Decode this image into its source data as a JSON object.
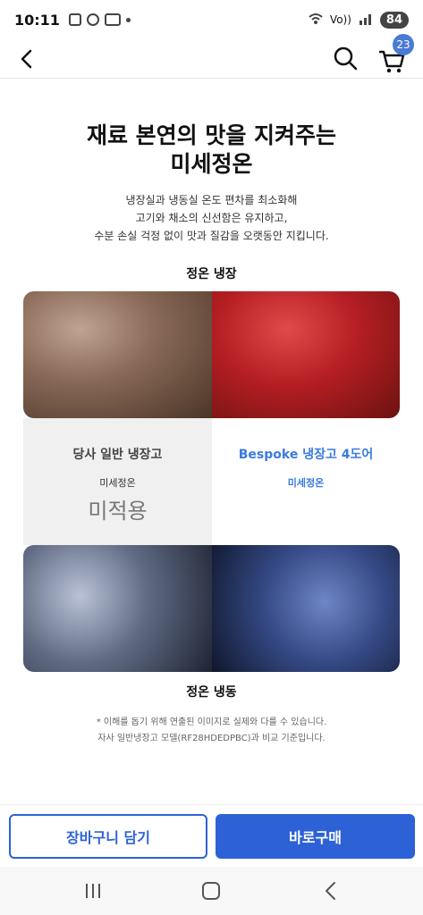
{
  "status_bar": {
    "time": "10:11",
    "network": "Vo))",
    "battery": "84"
  },
  "header": {
    "cart_count": "23"
  },
  "headline": {
    "line1": "재료 본연의 맛을 지켜주는",
    "line2": "미세정온"
  },
  "description": {
    "line1": "냉장실과 냉동실 온도 편차를 최소화해",
    "line2": "고기와 채소의 신선함은 유지하고,",
    "line3": "수분 손실 걱정 없이 맛과 질감을 오랫동안 지킵니다."
  },
  "section_fridge": "정온 냉장",
  "compare": {
    "left_title": "당사 일반 냉장고",
    "left_sub": "미세정온",
    "left_status": "미적용",
    "right_title": "Bespoke 냉장고 4도어",
    "right_sub": "미세정온"
  },
  "section_freezer": "정온 냉동",
  "footnote": {
    "line1": "* 이해를 돕기 위해 연출된 이미지로 실제와 다를 수 있습니다.",
    "line2": "자사 일반냉장고 모델(RF28HDEDPBC)과 비교 기준입니다."
  },
  "buttons": {
    "add_to_cart": "장바구니 담기",
    "buy_now": "바로구매"
  },
  "colors": {
    "accent": "#2d62d6",
    "badge": "#4a7bd4",
    "bespoke_text": "#3a7be0"
  }
}
